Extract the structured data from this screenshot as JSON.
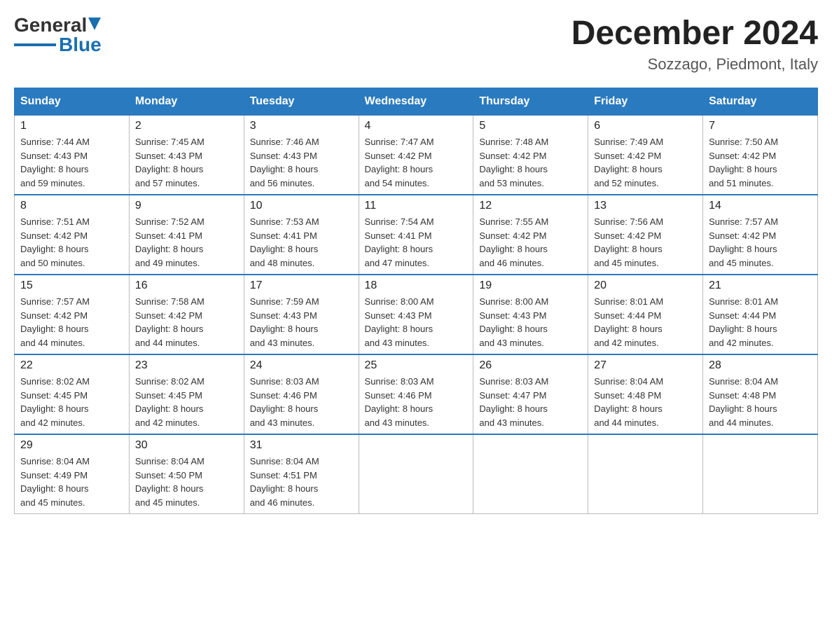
{
  "header": {
    "logo_general": "General",
    "logo_blue": "Blue",
    "month_year": "December 2024",
    "location": "Sozzago, Piedmont, Italy"
  },
  "days_of_week": [
    "Sunday",
    "Monday",
    "Tuesday",
    "Wednesday",
    "Thursday",
    "Friday",
    "Saturday"
  ],
  "weeks": [
    [
      {
        "day": "1",
        "sunrise": "7:44 AM",
        "sunset": "4:43 PM",
        "daylight": "8 hours and 59 minutes."
      },
      {
        "day": "2",
        "sunrise": "7:45 AM",
        "sunset": "4:43 PM",
        "daylight": "8 hours and 57 minutes."
      },
      {
        "day": "3",
        "sunrise": "7:46 AM",
        "sunset": "4:43 PM",
        "daylight": "8 hours and 56 minutes."
      },
      {
        "day": "4",
        "sunrise": "7:47 AM",
        "sunset": "4:42 PM",
        "daylight": "8 hours and 54 minutes."
      },
      {
        "day": "5",
        "sunrise": "7:48 AM",
        "sunset": "4:42 PM",
        "daylight": "8 hours and 53 minutes."
      },
      {
        "day": "6",
        "sunrise": "7:49 AM",
        "sunset": "4:42 PM",
        "daylight": "8 hours and 52 minutes."
      },
      {
        "day": "7",
        "sunrise": "7:50 AM",
        "sunset": "4:42 PM",
        "daylight": "8 hours and 51 minutes."
      }
    ],
    [
      {
        "day": "8",
        "sunrise": "7:51 AM",
        "sunset": "4:42 PM",
        "daylight": "8 hours and 50 minutes."
      },
      {
        "day": "9",
        "sunrise": "7:52 AM",
        "sunset": "4:41 PM",
        "daylight": "8 hours and 49 minutes."
      },
      {
        "day": "10",
        "sunrise": "7:53 AM",
        "sunset": "4:41 PM",
        "daylight": "8 hours and 48 minutes."
      },
      {
        "day": "11",
        "sunrise": "7:54 AM",
        "sunset": "4:41 PM",
        "daylight": "8 hours and 47 minutes."
      },
      {
        "day": "12",
        "sunrise": "7:55 AM",
        "sunset": "4:42 PM",
        "daylight": "8 hours and 46 minutes."
      },
      {
        "day": "13",
        "sunrise": "7:56 AM",
        "sunset": "4:42 PM",
        "daylight": "8 hours and 45 minutes."
      },
      {
        "day": "14",
        "sunrise": "7:57 AM",
        "sunset": "4:42 PM",
        "daylight": "8 hours and 45 minutes."
      }
    ],
    [
      {
        "day": "15",
        "sunrise": "7:57 AM",
        "sunset": "4:42 PM",
        "daylight": "8 hours and 44 minutes."
      },
      {
        "day": "16",
        "sunrise": "7:58 AM",
        "sunset": "4:42 PM",
        "daylight": "8 hours and 44 minutes."
      },
      {
        "day": "17",
        "sunrise": "7:59 AM",
        "sunset": "4:43 PM",
        "daylight": "8 hours and 43 minutes."
      },
      {
        "day": "18",
        "sunrise": "8:00 AM",
        "sunset": "4:43 PM",
        "daylight": "8 hours and 43 minutes."
      },
      {
        "day": "19",
        "sunrise": "8:00 AM",
        "sunset": "4:43 PM",
        "daylight": "8 hours and 43 minutes."
      },
      {
        "day": "20",
        "sunrise": "8:01 AM",
        "sunset": "4:44 PM",
        "daylight": "8 hours and 42 minutes."
      },
      {
        "day": "21",
        "sunrise": "8:01 AM",
        "sunset": "4:44 PM",
        "daylight": "8 hours and 42 minutes."
      }
    ],
    [
      {
        "day": "22",
        "sunrise": "8:02 AM",
        "sunset": "4:45 PM",
        "daylight": "8 hours and 42 minutes."
      },
      {
        "day": "23",
        "sunrise": "8:02 AM",
        "sunset": "4:45 PM",
        "daylight": "8 hours and 42 minutes."
      },
      {
        "day": "24",
        "sunrise": "8:03 AM",
        "sunset": "4:46 PM",
        "daylight": "8 hours and 43 minutes."
      },
      {
        "day": "25",
        "sunrise": "8:03 AM",
        "sunset": "4:46 PM",
        "daylight": "8 hours and 43 minutes."
      },
      {
        "day": "26",
        "sunrise": "8:03 AM",
        "sunset": "4:47 PM",
        "daylight": "8 hours and 43 minutes."
      },
      {
        "day": "27",
        "sunrise": "8:04 AM",
        "sunset": "4:48 PM",
        "daylight": "8 hours and 44 minutes."
      },
      {
        "day": "28",
        "sunrise": "8:04 AM",
        "sunset": "4:48 PM",
        "daylight": "8 hours and 44 minutes."
      }
    ],
    [
      {
        "day": "29",
        "sunrise": "8:04 AM",
        "sunset": "4:49 PM",
        "daylight": "8 hours and 45 minutes."
      },
      {
        "day": "30",
        "sunrise": "8:04 AM",
        "sunset": "4:50 PM",
        "daylight": "8 hours and 45 minutes."
      },
      {
        "day": "31",
        "sunrise": "8:04 AM",
        "sunset": "4:51 PM",
        "daylight": "8 hours and 46 minutes."
      },
      null,
      null,
      null,
      null
    ]
  ],
  "labels": {
    "sunrise_prefix": "Sunrise: ",
    "sunset_prefix": "Sunset: ",
    "daylight_prefix": "Daylight: "
  }
}
